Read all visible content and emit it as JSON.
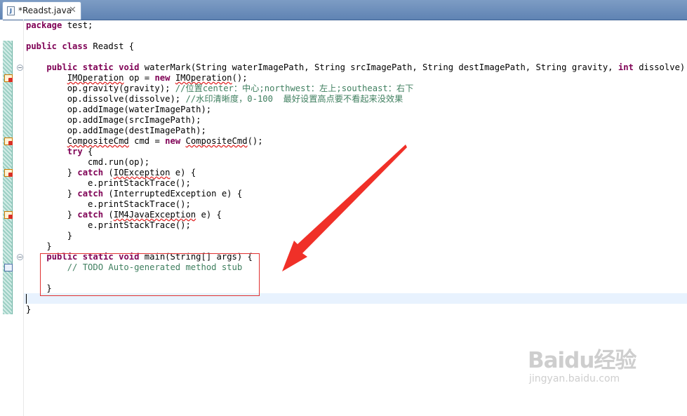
{
  "tab": {
    "title": "*Readst.java",
    "icon": "java-file-icon",
    "close_glyph": "✕",
    "icon_letter": "J"
  },
  "code_lines": [
    "package test;",
    "",
    "public class Readst {",
    "",
    "    public static void waterMark(String waterImagePath, String srcImagePath, String destImagePath, String gravity, int dissolve) {",
    "        IMOperation op = new IMOperation();",
    "        op.gravity(gravity); //位置center：中心;northwest：左上;southeast：右下",
    "        op.dissolve(dissolve); //水印清晰度，0-100  最好设置高点要不看起来没效果",
    "        op.addImage(waterImagePath);",
    "        op.addImage(srcImagePath);",
    "        op.addImage(destImagePath);",
    "        CompositeCmd cmd = new CompositeCmd();",
    "        try {",
    "            cmd.run(op);",
    "        } catch (IOException e) {",
    "            e.printStackTrace();",
    "        } catch (InterruptedException e) {",
    "            e.printStackTrace();",
    "        } catch (IM4JavaException e) {",
    "            e.printStackTrace();",
    "        }",
    "    }",
    "    public static void main(String[] args) {",
    "        // TODO Auto-generated method stub",
    "",
    "    }",
    "",
    "}"
  ],
  "gutter_markers": {
    "errors": [
      5,
      11,
      14,
      18
    ],
    "tasks": [
      23
    ]
  },
  "watermark": {
    "line1": "Baidu经验",
    "line2": "jingyan.baidu.com"
  },
  "colors": {
    "keyword": "#7f0055",
    "comment": "#3f7f5f",
    "annotation_red": "#e03030",
    "tab_bar": "#6b8fbd",
    "current_line": "#e8f2fe"
  }
}
